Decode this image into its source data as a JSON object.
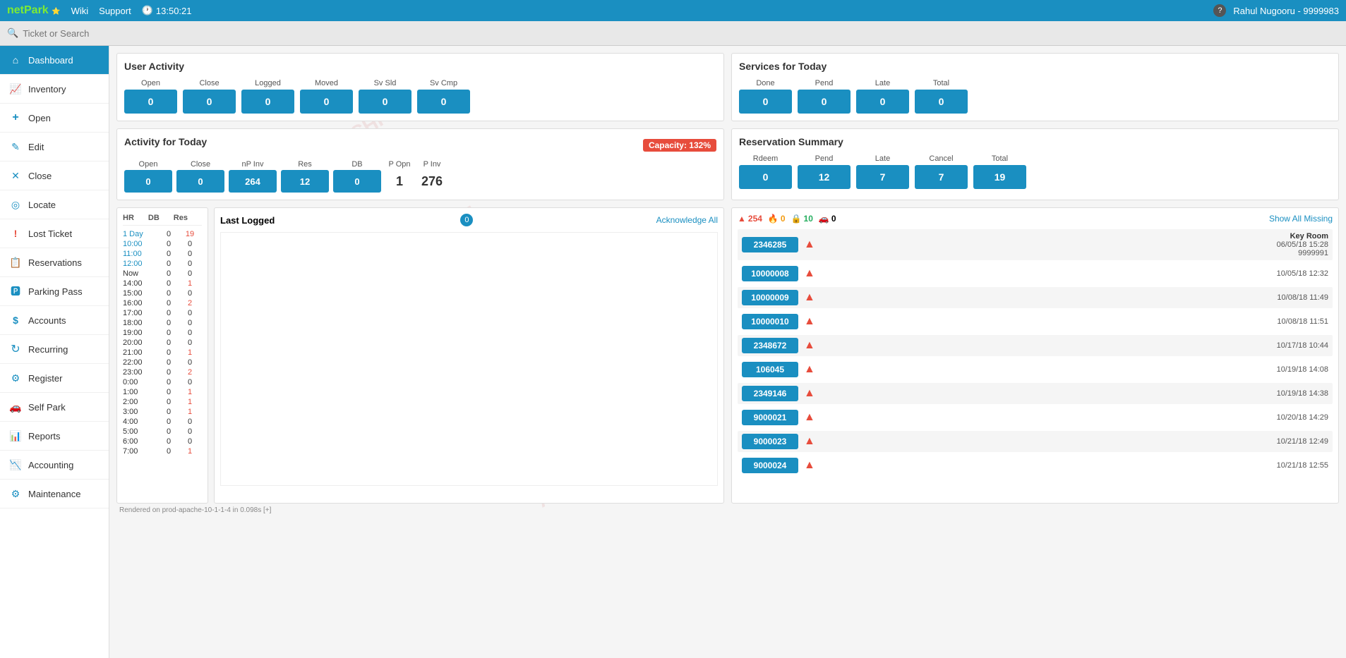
{
  "topnav": {
    "logo_net": "net",
    "logo_park": "Park",
    "wiki_label": "Wiki",
    "support_label": "Support",
    "time": "13:50:21",
    "user": "Rahul Nugooru - 9999983",
    "help": "?"
  },
  "search": {
    "placeholder": "Ticket or Search"
  },
  "sidebar": {
    "items": [
      {
        "id": "dashboard",
        "label": "Dashboard",
        "icon": "home",
        "active": true
      },
      {
        "id": "inventory",
        "label": "Inventory",
        "icon": "chart"
      },
      {
        "id": "open",
        "label": "Open",
        "icon": "plus"
      },
      {
        "id": "edit",
        "label": "Edit",
        "icon": "edit"
      },
      {
        "id": "close",
        "label": "Close",
        "icon": "close"
      },
      {
        "id": "locate",
        "label": "Locate",
        "icon": "locate"
      },
      {
        "id": "lost-ticket",
        "label": "Lost Ticket",
        "icon": "alert"
      },
      {
        "id": "reservations",
        "label": "Reservations",
        "icon": "reserve"
      },
      {
        "id": "parking-pass",
        "label": "Parking Pass",
        "icon": "pass"
      },
      {
        "id": "accounts",
        "label": "Accounts",
        "icon": "accounts"
      },
      {
        "id": "recurring",
        "label": "Recurring",
        "icon": "recurring"
      },
      {
        "id": "register",
        "label": "Register",
        "icon": "register"
      },
      {
        "id": "self-park",
        "label": "Self Park",
        "icon": "selfpark"
      },
      {
        "id": "reports",
        "label": "Reports",
        "icon": "reports"
      },
      {
        "id": "accounting",
        "label": "Accounting",
        "icon": "accounting"
      },
      {
        "id": "maintenance",
        "label": "Maintenance",
        "icon": "maintenance"
      }
    ]
  },
  "user_activity": {
    "title": "User Activity",
    "columns": [
      "Open",
      "Close",
      "Logged",
      "Moved",
      "Sv Sld",
      "Sv Cmp"
    ],
    "values": [
      "0",
      "0",
      "0",
      "0",
      "0",
      "0"
    ]
  },
  "services_today": {
    "title": "Services for Today",
    "columns": [
      "Done",
      "Pend",
      "Late",
      "Total"
    ],
    "values": [
      "0",
      "0",
      "0",
      "0"
    ]
  },
  "activity_today": {
    "title": "Activity for Today",
    "capacity_label": "Capacity: 132%",
    "columns": [
      "Open",
      "Close",
      "nP Inv",
      "Res",
      "DB",
      "P Opn",
      "P Inv"
    ],
    "values": [
      "0",
      "0",
      "264",
      "12",
      "0",
      "1",
      "276"
    ],
    "plain_cols": [
      5,
      6
    ]
  },
  "reservation_summary": {
    "title": "Reservation Summary",
    "columns": [
      "Rdeem",
      "Pend",
      "Late",
      "Cancel",
      "Total"
    ],
    "values": [
      "0",
      "12",
      "7",
      "7",
      "19"
    ]
  },
  "last_logged": {
    "title": "Last Logged",
    "count": "0",
    "ack_all": "Acknowledge All",
    "header": [
      "HR",
      "DB",
      "Res"
    ],
    "rows": [
      {
        "hr": "1 Day",
        "db": "0",
        "res": "19",
        "hr_colored": true
      },
      {
        "hr": "10:00",
        "db": "0",
        "res": "0",
        "hr_colored": true
      },
      {
        "hr": "11:00",
        "db": "0",
        "res": "0",
        "hr_colored": true
      },
      {
        "hr": "12:00",
        "db": "0",
        "res": "0",
        "hr_colored": true
      },
      {
        "hr": "Now",
        "db": "0",
        "res": "0"
      },
      {
        "hr": "14:00",
        "db": "0",
        "res": "1"
      },
      {
        "hr": "15:00",
        "db": "0",
        "res": "0"
      },
      {
        "hr": "16:00",
        "db": "0",
        "res": "2"
      },
      {
        "hr": "17:00",
        "db": "0",
        "res": "0"
      },
      {
        "hr": "18:00",
        "db": "0",
        "res": "0"
      },
      {
        "hr": "19:00",
        "db": "0",
        "res": "0"
      },
      {
        "hr": "20:00",
        "db": "0",
        "res": "0"
      },
      {
        "hr": "21:00",
        "db": "0",
        "res": "1"
      },
      {
        "hr": "22:00",
        "db": "0",
        "res": "0"
      },
      {
        "hr": "23:00",
        "db": "0",
        "res": "2"
      },
      {
        "hr": "0:00",
        "db": "0",
        "res": "0"
      },
      {
        "hr": "1:00",
        "db": "0",
        "res": "1"
      },
      {
        "hr": "2:00",
        "db": "0",
        "res": "1"
      },
      {
        "hr": "3:00",
        "db": "0",
        "res": "1"
      },
      {
        "hr": "4:00",
        "db": "0",
        "res": "0"
      },
      {
        "hr": "5:00",
        "db": "0",
        "res": "0"
      },
      {
        "hr": "6:00",
        "db": "0",
        "res": "0"
      },
      {
        "hr": "7:00",
        "db": "0",
        "res": "1"
      }
    ]
  },
  "alerts": {
    "red_count": "254",
    "orange_count": "0",
    "green_count": "10",
    "car_count": "0",
    "show_missing": "Show All Missing",
    "rows": [
      {
        "ticket": "2346285",
        "has_keyroom": true,
        "keyroom_label": "Key Room",
        "timestamp": "06/05/18 15:28",
        "user": "9999991"
      },
      {
        "ticket": "10000008",
        "has_keyroom": false,
        "timestamp": "10/05/18 12:32",
        "user": ""
      },
      {
        "ticket": "10000009",
        "has_keyroom": false,
        "timestamp": "10/08/18 11:49",
        "user": ""
      },
      {
        "ticket": "10000010",
        "has_keyroom": false,
        "timestamp": "10/08/18 11:51",
        "user": ""
      },
      {
        "ticket": "2348672",
        "has_keyroom": false,
        "timestamp": "10/17/18 10:44",
        "user": ""
      },
      {
        "ticket": "106045",
        "has_keyroom": false,
        "timestamp": "10/19/18 14:08",
        "user": ""
      },
      {
        "ticket": "2349146",
        "has_keyroom": false,
        "timestamp": "10/19/18 14:38",
        "user": ""
      },
      {
        "ticket": "9000021",
        "has_keyroom": false,
        "timestamp": "10/20/18 14:29",
        "user": ""
      },
      {
        "ticket": "9000023",
        "has_keyroom": false,
        "timestamp": "10/21/18 12:49",
        "user": ""
      },
      {
        "ticket": "9000024",
        "has_keyroom": false,
        "timestamp": "10/21/18 12:55",
        "user": ""
      }
    ]
  },
  "footer": {
    "rendered": "Rendered on prod-apache-10-1-1-4 in 0.098s [+]"
  }
}
